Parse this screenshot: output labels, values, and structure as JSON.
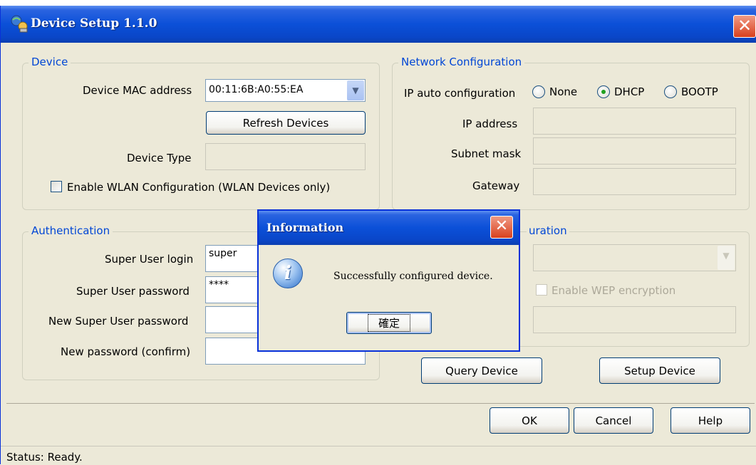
{
  "window": {
    "title": "Device Setup 1.1.0",
    "close_glyph": "✕",
    "icon": "network-setup-icon"
  },
  "device": {
    "legend": "Device",
    "mac_label": "Device MAC address",
    "mac_value": "00:11:6B:A0:55:EA",
    "refresh_button": "Refresh Devices",
    "type_label": "Device Type",
    "type_value": "",
    "wlan_checkbox_label": "Enable WLAN Configuration (WLAN Devices only)",
    "wlan_checked": false
  },
  "network": {
    "legend": "Network Configuration",
    "ip_auto_label": "IP auto configuration",
    "options": [
      "None",
      "DHCP",
      "BOOTP"
    ],
    "selected": "DHCP",
    "ip_label": "IP address",
    "subnet_label": "Subnet mask",
    "gateway_label": "Gateway"
  },
  "auth": {
    "legend": "Authentication",
    "login_label": "Super User login",
    "login_value": "super",
    "password_label": "Super User password",
    "password_value": "****",
    "new_password_label": "New Super User password",
    "confirm_label": "New password (confirm)"
  },
  "wlan": {
    "legend_partial": "uration",
    "wep_label": "Enable WEP encryption"
  },
  "actions": {
    "query": "Query Device",
    "setup": "Setup Device",
    "ok": "OK",
    "cancel": "Cancel",
    "help": "Help"
  },
  "status": {
    "text": "Status: Ready."
  },
  "dialog": {
    "title": "Information",
    "message": "Successfully configured device.",
    "ok_label": "確定",
    "close_glyph": "✕",
    "icon": "info-icon"
  },
  "colors": {
    "titlebar": "#0b50d8",
    "legend_text": "#0046d5",
    "dialog_face": "#ece9d8",
    "close_red": "#d9401e"
  }
}
